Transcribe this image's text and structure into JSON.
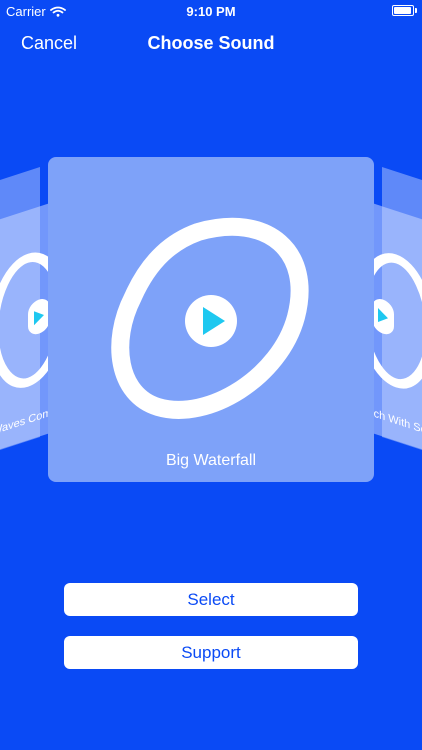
{
  "status_bar": {
    "carrier": "Carrier",
    "time": "9:10 PM",
    "battery_percent": 85
  },
  "nav": {
    "cancel_label": "Cancel",
    "title": "Choose Sound"
  },
  "carousel": {
    "left_card_label": "Waves Coming With Wind",
    "main_card_label": "Big Waterfall",
    "right_card_label": "Beach With Seagull"
  },
  "actions": {
    "select_label": "Select",
    "support_label": "Support"
  },
  "colors": {
    "background": "#0a4af5",
    "card": "#7ea2f9",
    "play_triangle": "#1ec8f0",
    "button_text": "#0a4af5"
  },
  "icons": {
    "wifi": "wifi-icon",
    "battery": "battery-icon",
    "play": "play-icon",
    "doodle": "hand-drawn-circle"
  }
}
